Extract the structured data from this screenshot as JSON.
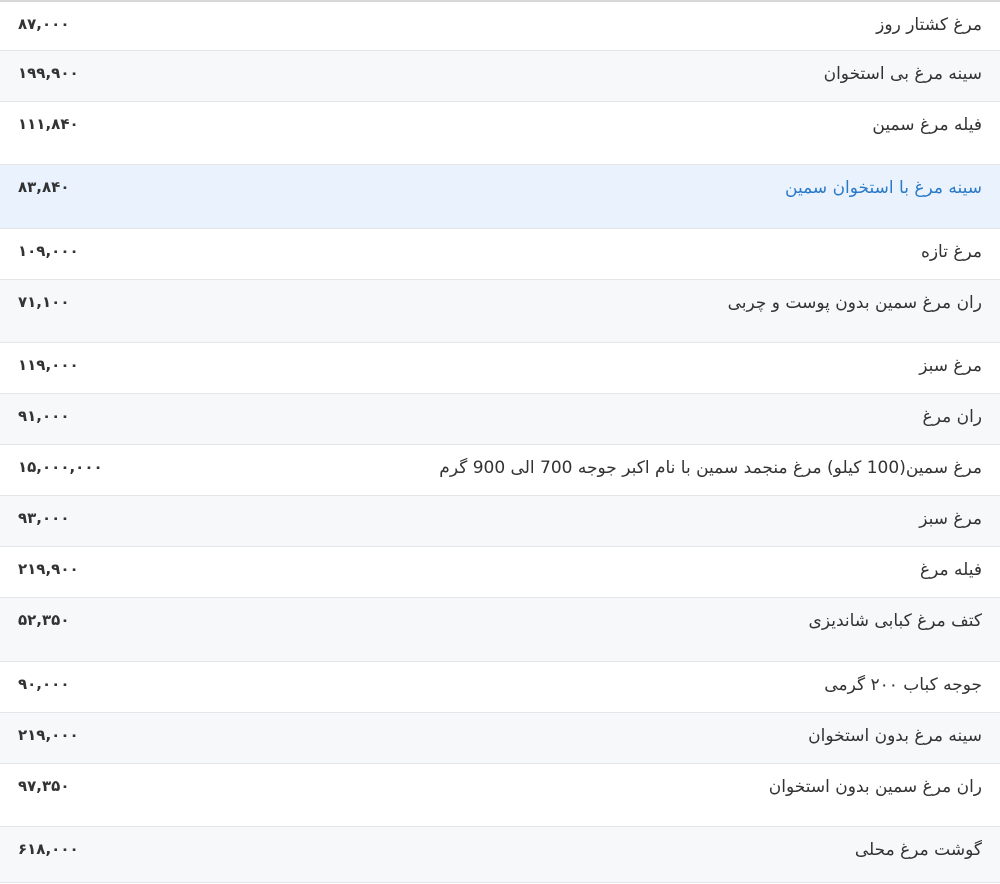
{
  "rows": [
    {
      "name": "مرغ کشتار روز",
      "price": "۸۷,۰۰۰"
    },
    {
      "name": "سینه مرغ بی استخوان",
      "price": "۱۹۹,۹۰۰"
    },
    {
      "name": "فیله مرغ سمین",
      "price": "۱۱۱,۸۴۰"
    },
    {
      "name": "سینه مرغ با استخوان سمین",
      "price": "۸۳,۸۴۰"
    },
    {
      "name": "مرغ تازه",
      "price": "۱۰۹,۰۰۰"
    },
    {
      "name": "ران مرغ سمین بدون پوست و چربی",
      "price": "۷۱,۱۰۰"
    },
    {
      "name": "مرغ سبز",
      "price": "۱۱۹,۰۰۰"
    },
    {
      "name": "ران مرغ",
      "price": "۹۱,۰۰۰"
    },
    {
      "name": "مرغ سمین(100 کیلو) مرغ منجمد سمین با نام اکبر جوجه 700 الی 900 گرم",
      "price": "۱۵,۰۰۰,۰۰۰"
    },
    {
      "name": "مرغ سبز",
      "price": "۹۳,۰۰۰"
    },
    {
      "name": "فیله مرغ",
      "price": "۲۱۹,۹۰۰"
    },
    {
      "name": "کتف مرغ کبابی شاندیزی",
      "price": "۵۲,۳۵۰"
    },
    {
      "name": "جوجه کباب ۲۰۰ گرمی",
      "price": "۹۰,۰۰۰"
    },
    {
      "name": "سینه مرغ بدون استخوان",
      "price": "۲۱۹,۰۰۰"
    },
    {
      "name": "ران مرغ سمین بدون استخوان",
      "price": "۹۷,۳۵۰"
    },
    {
      "name": "گوشت مرغ محلی",
      "price": "۶۱۸,۰۰۰"
    }
  ],
  "highlight_color": "#2a7ac9"
}
